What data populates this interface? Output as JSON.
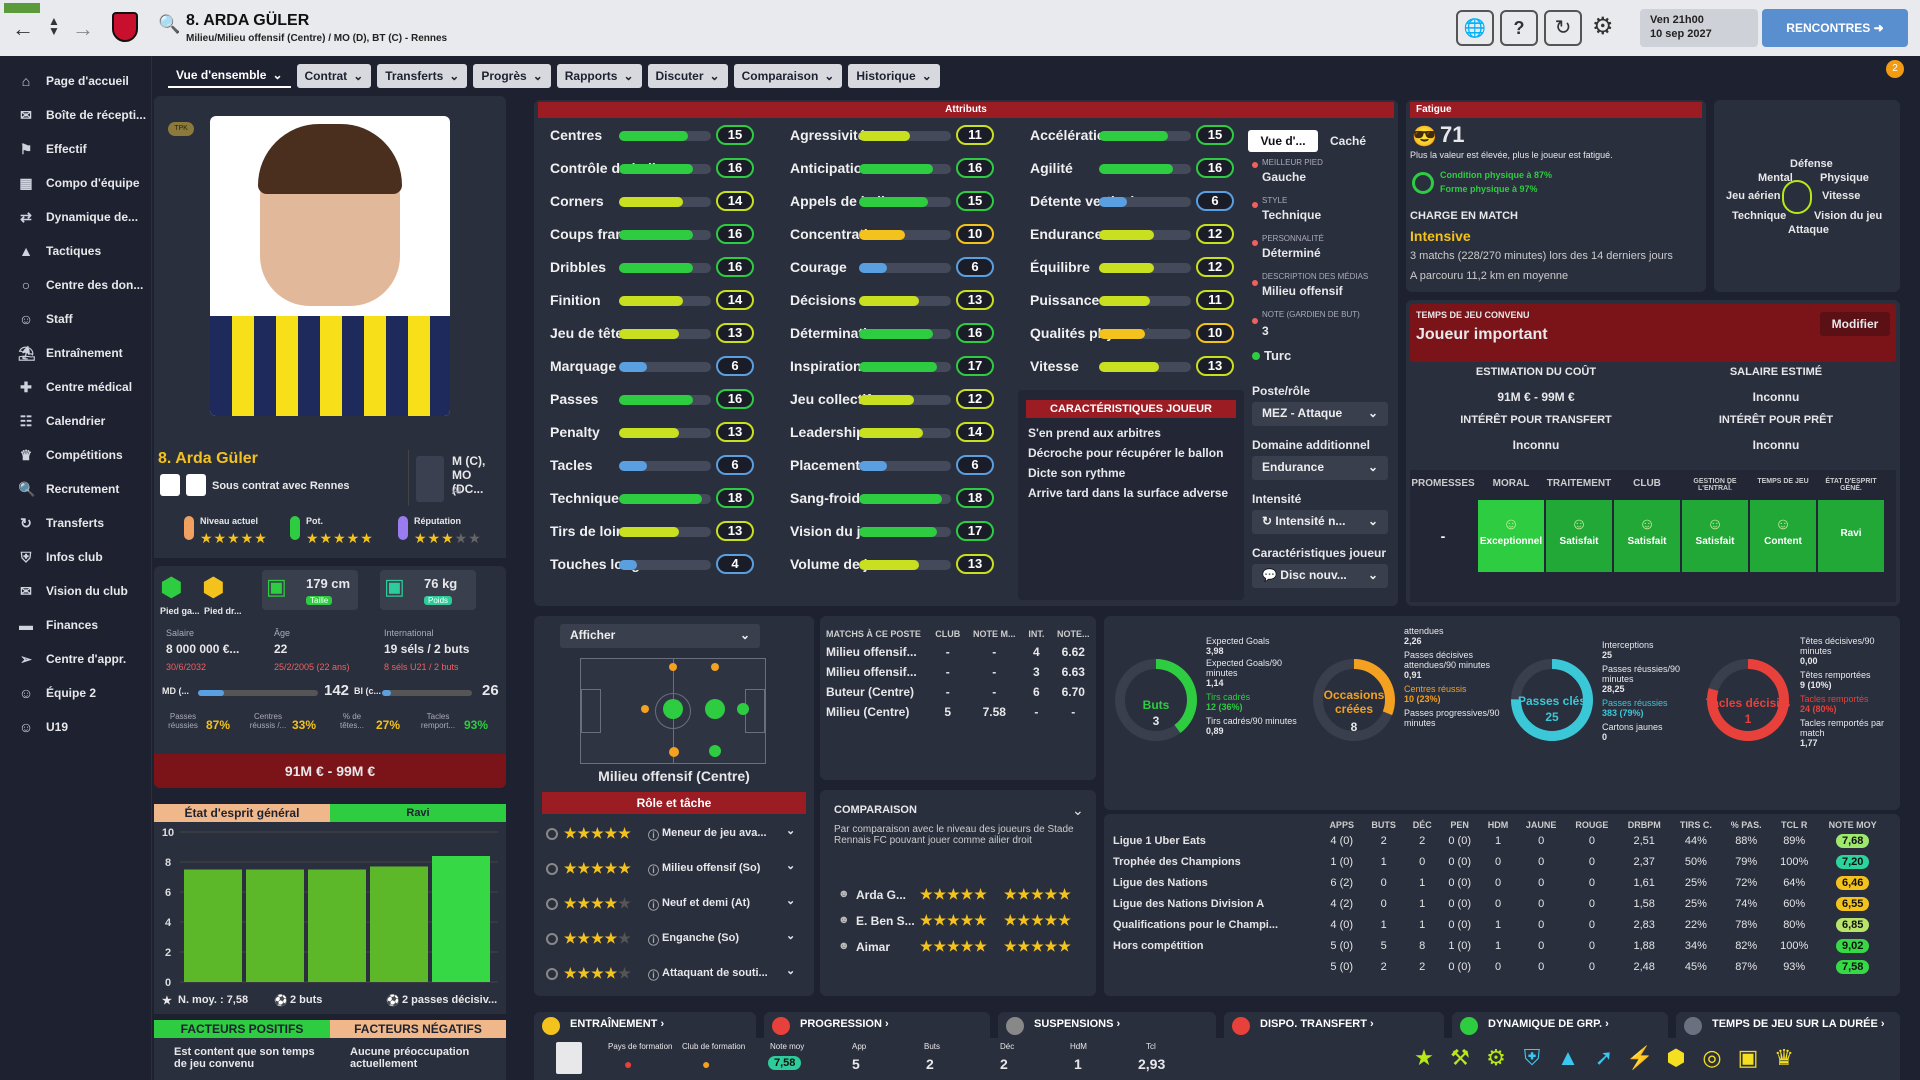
{
  "header": {
    "player_title": "8. ARDA GÜLER",
    "player_subtitle": "Milieu/Milieu offensif (Centre) / MO (D), BT (C) - Rennes",
    "date_line1": "Ven 21h00",
    "date_line2": "10 sep 2027",
    "matches_button": "RENCONTRES",
    "notif_count": "2"
  },
  "tabs": [
    "Vue d'ensemble",
    "Contrat",
    "Transferts",
    "Progrès",
    "Rapports",
    "Discuter",
    "Comparaison",
    "Historique"
  ],
  "sidebar": [
    "Page d'accueil",
    "Boîte de récepti...",
    "Effectif",
    "Compo d'équipe",
    "Dynamique de...",
    "Tactiques",
    "Centre des don...",
    "Staff",
    "Entraînement",
    "Centre médical",
    "Calendrier",
    "Compétitions",
    "Recrutement",
    "Transferts",
    "Infos club",
    "Vision du club",
    "Finances",
    "Centre d'appr.",
    "Équipe 2",
    "U19"
  ],
  "profile": {
    "name": "8. Arda Güler",
    "contract": "Sous contrat avec Rennes",
    "positions": "M (C), MO (DC...",
    "positions_ai": "AI",
    "current_level": "Niveau actuel",
    "potential": "Pot.",
    "reputation": "Réputation",
    "tpk": "TPK"
  },
  "physical": {
    "left_foot": "Pied ga...",
    "right_foot": "Pied dr...",
    "height": "179 cm",
    "height_label": "Taille",
    "weight": "76 kg",
    "weight_label": "Poids"
  },
  "info": {
    "salary_label": "Salaire",
    "salary": "8 000 000 €...",
    "salary_date": "30/6/2032",
    "age_label": "Âge",
    "age": "22",
    "birth": "25/2/2005 (22 ans)",
    "intl_label": "International",
    "intl": "19 séls / 2 buts",
    "u21": "8 séls U21 / 2 buts",
    "md_label": "MD (...",
    "md_val": "142",
    "bi_label": "BI (c...",
    "bi_val": "26",
    "passes_label": "Passes réussies",
    "passes": "87%",
    "centres_label": "Centres réussis /...",
    "centres": "33%",
    "tetes_label": "% de têtes...",
    "tetes": "27%",
    "tacles_label": "Tacles remport...",
    "tacles": "93%",
    "value": "91M € - 99M €"
  },
  "morale": {
    "tab1": "État d'esprit général",
    "tab2": "Ravi",
    "y_ticks": [
      "10",
      "8",
      "6",
      "4",
      "2",
      "0"
    ],
    "bars": [
      7.5,
      7.5,
      7.5,
      7.7,
      8.4
    ],
    "foot1": "N. moy. : 7,58",
    "foot2": "2 buts",
    "foot3": "2 passes décisiv..."
  },
  "factors": {
    "positive": "FACTEURS POSITIFS",
    "negative": "FACTEURS NÉGATIFS",
    "pos_item": "Est content que son temps de jeu convenu",
    "neg_item": "Aucune préoccupation actuellement"
  },
  "attributes": {
    "title": "Attributs",
    "col1": [
      {
        "n": "Centres",
        "v": "15"
      },
      {
        "n": "Contrôle de balle",
        "v": "16"
      },
      {
        "n": "Corners",
        "v": "14"
      },
      {
        "n": "Coups francs",
        "v": "16"
      },
      {
        "n": "Dribbles",
        "v": "16"
      },
      {
        "n": "Finition",
        "v": "14"
      },
      {
        "n": "Jeu de tête",
        "v": "13"
      },
      {
        "n": "Marquage",
        "v": "6"
      },
      {
        "n": "Passes",
        "v": "16"
      },
      {
        "n": "Penalty",
        "v": "13"
      },
      {
        "n": "Tacles",
        "v": "6"
      },
      {
        "n": "Technique",
        "v": "18"
      },
      {
        "n": "Tirs de loin",
        "v": "13"
      },
      {
        "n": "Touches longues",
        "v": "4"
      }
    ],
    "col2": [
      {
        "n": "Agressivité",
        "v": "11"
      },
      {
        "n": "Anticipation",
        "v": "16"
      },
      {
        "n": "Appels de balle",
        "v": "15"
      },
      {
        "n": "Concentration",
        "v": "10"
      },
      {
        "n": "Courage",
        "v": "6"
      },
      {
        "n": "Décisions",
        "v": "13"
      },
      {
        "n": "Détermination",
        "v": "16"
      },
      {
        "n": "Inspiration",
        "v": "17"
      },
      {
        "n": "Jeu collectif",
        "v": "12"
      },
      {
        "n": "Leadership",
        "v": "14"
      },
      {
        "n": "Placement",
        "v": "6"
      },
      {
        "n": "Sang-froid",
        "v": "18"
      },
      {
        "n": "Vision du jeu",
        "v": "17"
      },
      {
        "n": "Volume de jeu",
        "v": "13"
      }
    ],
    "col3": [
      {
        "n": "Accélération",
        "v": "15"
      },
      {
        "n": "Agilité",
        "v": "16"
      },
      {
        "n": "Détente verticale",
        "v": "6"
      },
      {
        "n": "Endurance",
        "v": "12"
      },
      {
        "n": "Équilibre",
        "v": "12"
      },
      {
        "n": "Puissance",
        "v": "11"
      },
      {
        "n": "Qualités phys. nat.",
        "v": "10"
      },
      {
        "n": "Vitesse",
        "v": "13"
      }
    ]
  },
  "player_info": {
    "view_btn": "Vue d'...",
    "hidden_btn": "Caché",
    "foot_label": "MEILLEUR PIED",
    "foot": "Gauche",
    "style_label": "STYLE",
    "style": "Technique",
    "pers_label": "PERSONNALITÉ",
    "pers": "Déterminé",
    "media_label": "DESCRIPTION DES MÉDIAS",
    "media": "Milieu offensif",
    "gk_label": "NOTE (GARDIEN DE BUT)",
    "gk": "3",
    "nation": "Turc",
    "role_label": "Poste/rôle",
    "role": "MEZ - Attaque",
    "domain_label": "Domaine additionnel",
    "domain": "Endurance",
    "intensity_label": "Intensité",
    "intensity": "Intensité n...",
    "traits_label": "Caractéristiques joueur",
    "traits": "Disc nouv..."
  },
  "traits": {
    "title": "CARACTÉRISTIQUES JOUEUR",
    "items": [
      "S'en prend aux arbitres",
      "Décroche pour récupérer le ballon",
      "Dicte son rythme",
      "Arrive tard dans la surface adverse"
    ]
  },
  "fatigue": {
    "title": "Fatigue",
    "value": "71",
    "desc": "Plus la valeur est élevée, plus le joueur est fatigué.",
    "cond": "Condition physique à 87%",
    "form": "Forme physique à 97%",
    "load_label": "CHARGE EN MATCH",
    "load": "Intensive",
    "load_desc": "3 matchs (228/270 minutes) lors des 14 derniers jours",
    "distance": "A parcouru 11,2 km en moyenne"
  },
  "radar": {
    "def": "Défense",
    "mental": "Mental",
    "phys": "Physique",
    "air": "Jeu aérien",
    "speed": "Vitesse",
    "tech": "Technique",
    "vision": "Vision du jeu",
    "att": "Attaque"
  },
  "playtime": {
    "label": "TEMPS DE JEU CONVENU",
    "value": "Joueur important",
    "modify": "Modifier",
    "cost_label": "ESTIMATION DU COÛT",
    "cost": "91M € - 99M €",
    "salary_label": "SALAIRE ESTIMÉ",
    "salary": "Inconnu",
    "transfer_label": "INTÉRÊT POUR TRANSFERT",
    "transfer": "Inconnu",
    "loan_label": "INTÉRÊT POUR PRÊT",
    "loan": "Inconnu"
  },
  "morale_grid": {
    "headers": [
      "PROMESSES",
      "MORAL",
      "TRAITEMENT",
      "CLUB",
      "GESTION DE L'ENTRAÎ.",
      "TEMPS DE JEU",
      "ÉTAT D'ESPRIT GÉNÉ."
    ],
    "values": [
      "-",
      "Exceptionnel",
      "Satisfait",
      "Satisfait",
      "Satisfait",
      "Content",
      "Ravi"
    ]
  },
  "position": {
    "dropdown": "Afficher",
    "name": "Milieu offensif (Centre)"
  },
  "roles": {
    "title": "Rôle et tâche",
    "items": [
      {
        "r": "Meneur de jeu ava...",
        "s": 5
      },
      {
        "r": "Milieu offensif (So)",
        "s": 5
      },
      {
        "r": "Neuf et demi (At)",
        "s": 4
      },
      {
        "r": "Enganche (So)",
        "s": 4
      },
      {
        "r": "Attaquant de souti...",
        "s": 4
      }
    ]
  },
  "matches_pos": {
    "headers": [
      "MATCHS À CE POSTE",
      "CLUB",
      "NOTE M...",
      "INT.",
      "NOTE..."
    ],
    "rows": [
      [
        "Milieu offensif...",
        "-",
        "-",
        "4",
        "6.62"
      ],
      [
        "Milieu offensif...",
        "-",
        "-",
        "3",
        "6.63"
      ],
      [
        "Buteur (Centre)",
        "-",
        "-",
        "6",
        "6.70"
      ],
      [
        "Milieu (Centre)",
        "5",
        "7.58",
        "-",
        "-"
      ]
    ]
  },
  "comparison": {
    "title": "COMPARAISON",
    "desc": "Par comparaison avec le niveau des joueurs de Stade Rennais FC pouvant jouer comme ailier droit",
    "players": [
      "Arda G...",
      "E. Ben S...",
      "Aimar"
    ]
  },
  "stats": {
    "goals_gauge": "Buts",
    "goals": "3",
    "chances_gauge": "Occasions créées",
    "chances": "8",
    "keypass_gauge": "Passes clés",
    "keypass": "25",
    "tackles_gauge": "Tacles décisifs",
    "tackles": "1",
    "xg_label": "Expected Goals",
    "xg": "3,98",
    "xg90_label": "Expected Goals/90 minutes",
    "xg90": "1,14",
    "shots_label": "Tirs cadrés",
    "shots": "12 (36%)",
    "shots90_label": "Tirs cadrés/90 minutes",
    "shots90": "0,89",
    "att_label": "attendues",
    "att": "2,26",
    "xa90_label": "Passes décisives attendues/90 minutes",
    "xa90": "0,91",
    "cross_label": "Centres réussis",
    "cross": "10 (23%)",
    "prog_label": "Passes progressives/90 minutes",
    "int_label": "Interceptions",
    "int": "25",
    "pass90_label": "Passes réussies/90 minutes",
    "pass90": "28,25",
    "passok_label": "Passes réussies",
    "passok": "383 (79%)",
    "yellow_label": "Cartons jaunes",
    "yellow": "0",
    "hdec_label": "Têtes décisives/90 minutes",
    "hdec": "0,00",
    "hwon_label": "Têtes remportées",
    "hwon": "9 (10%)",
    "tw_label": "Tacles remportés",
    "tw": "24 (80%)",
    "tw90_label": "Tacles remportés par match",
    "tw90": "1,77"
  },
  "competitions": {
    "headers": [
      "APPS",
      "BUTS",
      "DÉC",
      "PEN",
      "HDM",
      "JAUNE",
      "ROUGE",
      "DRBPM",
      "TIRS C.",
      "% PAS.",
      "TCL R",
      "NOTE MOY"
    ],
    "rows": [
      [
        "Ligue 1 Uber Eats",
        "4 (0)",
        "2",
        "2",
        "0 (0)",
        "1",
        "0",
        "0",
        "2,51",
        "44%",
        "88%",
        "89%",
        "7,68"
      ],
      [
        "Trophée des Champions",
        "1 (0)",
        "1",
        "0",
        "0 (0)",
        "0",
        "0",
        "0",
        "2,37",
        "50%",
        "79%",
        "100%",
        "7,20"
      ],
      [
        "Ligue des Nations",
        "6 (2)",
        "0",
        "1",
        "0 (0)",
        "0",
        "0",
        "0",
        "1,61",
        "25%",
        "72%",
        "64%",
        "6,46"
      ],
      [
        "Ligue des Nations Division A",
        "4 (2)",
        "0",
        "1",
        "0 (0)",
        "0",
        "0",
        "0",
        "1,58",
        "25%",
        "74%",
        "60%",
        "6,55"
      ],
      [
        "Qualifications pour le Champi...",
        "4 (0)",
        "1",
        "1",
        "0 (0)",
        "1",
        "0",
        "0",
        "2,83",
        "22%",
        "78%",
        "80%",
        "6,85"
      ],
      [
        "Hors compétition",
        "5 (0)",
        "5",
        "8",
        "1 (0)",
        "1",
        "0",
        "0",
        "1,88",
        "34%",
        "82%",
        "100%",
        "9,02"
      ],
      [
        "",
        "5 (0)",
        "2",
        "2",
        "0 (0)",
        "0",
        "0",
        "0",
        "2,48",
        "45%",
        "87%",
        "93%",
        "7,58"
      ]
    ],
    "note_colors": [
      "#9ee86e",
      "#2bd49a",
      "#f4c21c",
      "#f4c21c",
      "#b9e46a",
      "#37d846",
      "#37d846"
    ]
  },
  "bottom_tabs": [
    "ENTRAÎNEMENT",
    "PROGRESSION",
    "SUSPENSIONS",
    "DISPO. TRANSFERT",
    "DYNAMIQUE DE GRP.",
    "TEMPS DE JEU SUR LA DURÉE"
  ],
  "footer": {
    "form_label": "Pays de formation",
    "club_label": "Club de formation",
    "note_label": "Note moy",
    "note": "7,58",
    "app_label": "App",
    "app": "5",
    "goals_label": "Buts",
    "goals": "2",
    "dec_label": "Déc",
    "dec": "2",
    "hdm_label": "HdM",
    "hdm": "1",
    "tcl_label": "Tcl",
    "tcl": "2,93"
  }
}
